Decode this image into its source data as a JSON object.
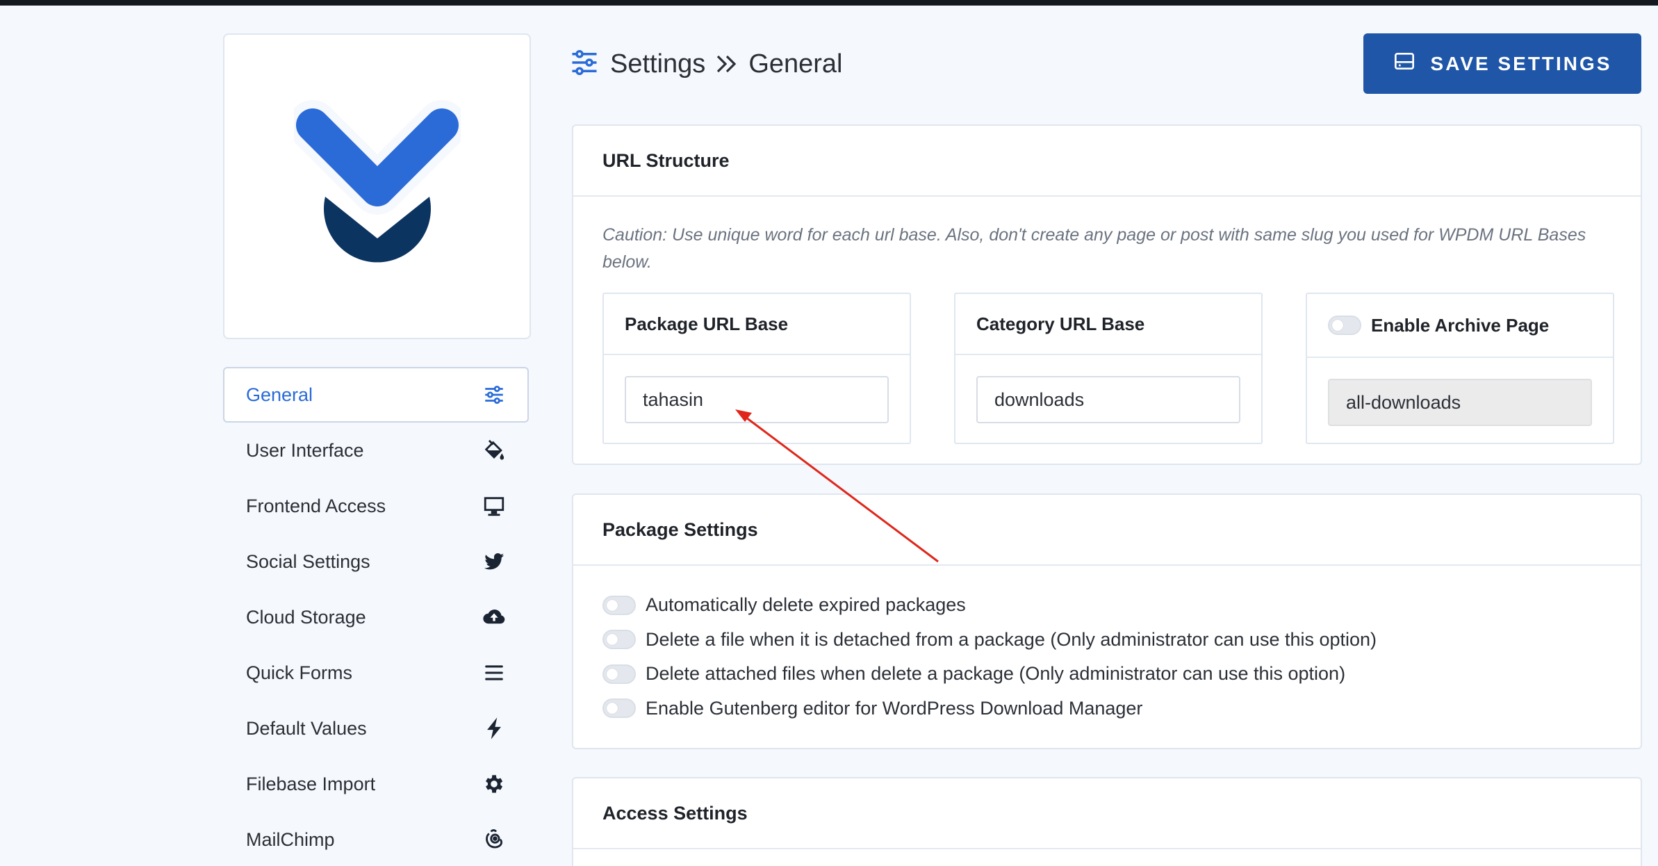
{
  "page": {
    "title": "Settings",
    "section": "General"
  },
  "save_button": {
    "label": "SAVE SETTINGS",
    "icon": "hard-drive-icon"
  },
  "sidebar": {
    "items": [
      {
        "label": "General",
        "icon": "sliders-icon",
        "active": true
      },
      {
        "label": "User Interface",
        "icon": "paint-bucket-icon"
      },
      {
        "label": "Frontend Access",
        "icon": "desktop-icon"
      },
      {
        "label": "Social Settings",
        "icon": "twitter-icon"
      },
      {
        "label": "Cloud Storage",
        "icon": "cloud-upload-icon"
      },
      {
        "label": "Quick Forms",
        "icon": "bars-icon"
      },
      {
        "label": "Default Values",
        "icon": "bolt-icon"
      },
      {
        "label": "Filebase Import",
        "icon": "gear-icon"
      },
      {
        "label": "MailChimp",
        "icon": "mailchimp-icon"
      }
    ]
  },
  "url_structure": {
    "title": "URL Structure",
    "caution": "Caution: Use unique word for each url base. Also, don't create any page or post with same slug you used for WPDM URL Bases below.",
    "package_base": {
      "label": "Package URL Base",
      "value": "tahasin"
    },
    "category_base": {
      "label": "Category URL Base",
      "value": "downloads"
    },
    "archive": {
      "label": "Enable Archive Page",
      "value": "all-downloads",
      "enabled": false
    }
  },
  "package_settings": {
    "title": "Package Settings",
    "options": [
      {
        "label": "Automatically delete expired packages",
        "enabled": false
      },
      {
        "label": "Delete a file when it is detached from a package (Only administrator can use this option)",
        "enabled": false
      },
      {
        "label": "Delete attached files when delete a package (Only administrator can use this option)",
        "enabled": false
      },
      {
        "label": "Enable Gutenberg editor for WordPress Download Manager",
        "enabled": false
      }
    ]
  },
  "access_settings": {
    "title": "Access Settings"
  },
  "colors": {
    "brand_blue": "#2a6bd8",
    "brand_navy": "#0c3461",
    "save_button": "#1f56a8",
    "annotation_arrow": "#e0261b"
  }
}
